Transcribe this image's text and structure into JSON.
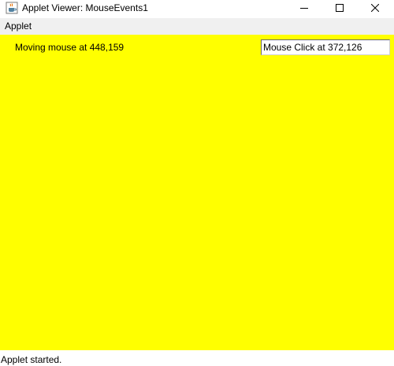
{
  "window": {
    "title": "Applet Viewer: MouseEvents1",
    "app_icon": "java-cup-icon",
    "controls": [
      "minimize-icon",
      "maximize-icon",
      "close-icon"
    ]
  },
  "menubar": {
    "items": [
      {
        "label": "Applet"
      }
    ]
  },
  "applet": {
    "background_color": "#ffff00",
    "moving_text": "Moving mouse at 448,159",
    "click_field_value": "Mouse Click at 372,126"
  },
  "status": {
    "text": "Applet started."
  }
}
